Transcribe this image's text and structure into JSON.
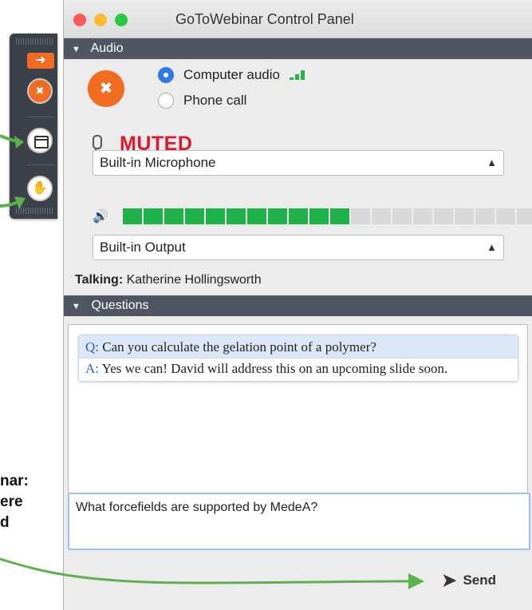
{
  "window": {
    "title": "GoToWebinar Control Panel"
  },
  "audio": {
    "section_label": "Audio",
    "computer_audio_label": "Computer audio",
    "phone_call_label": "Phone call",
    "selected_mode": "Computer audio",
    "status": "MUTED",
    "microphone_selected": "Built-in Microphone",
    "output_selected": "Built-in Output",
    "volume_level_segments_lit": 11,
    "volume_level_segments_total": 20,
    "talking_label": "Talking:",
    "talking_name": "Katherine  Hollingsworth"
  },
  "questions": {
    "section_label": "Questions",
    "items": [
      {
        "q_prefix": "Q:",
        "question": "Can you calculate the gelation point of a polymer?",
        "a_prefix": "A:",
        "answer": "Yes we can! David will address this on an upcoming slide soon."
      }
    ],
    "input_value": "What forcefields are supported by MedeA?",
    "send_label": "Send"
  },
  "annotation": {
    "line1": "nar:",
    "line2": "ere",
    "line3": "d"
  },
  "colors": {
    "accent_orange": "#f26c21",
    "muted_red": "#e0192a",
    "level_green": "#1fb24a",
    "header_gray": "#4f5661",
    "arrow_green": "#5cb24a"
  },
  "icons": [
    "arrow-right-icon",
    "mic-muted-icon",
    "screen-icon",
    "raise-hand-icon",
    "microphone-icon",
    "speaker-icon",
    "send-icon"
  ]
}
